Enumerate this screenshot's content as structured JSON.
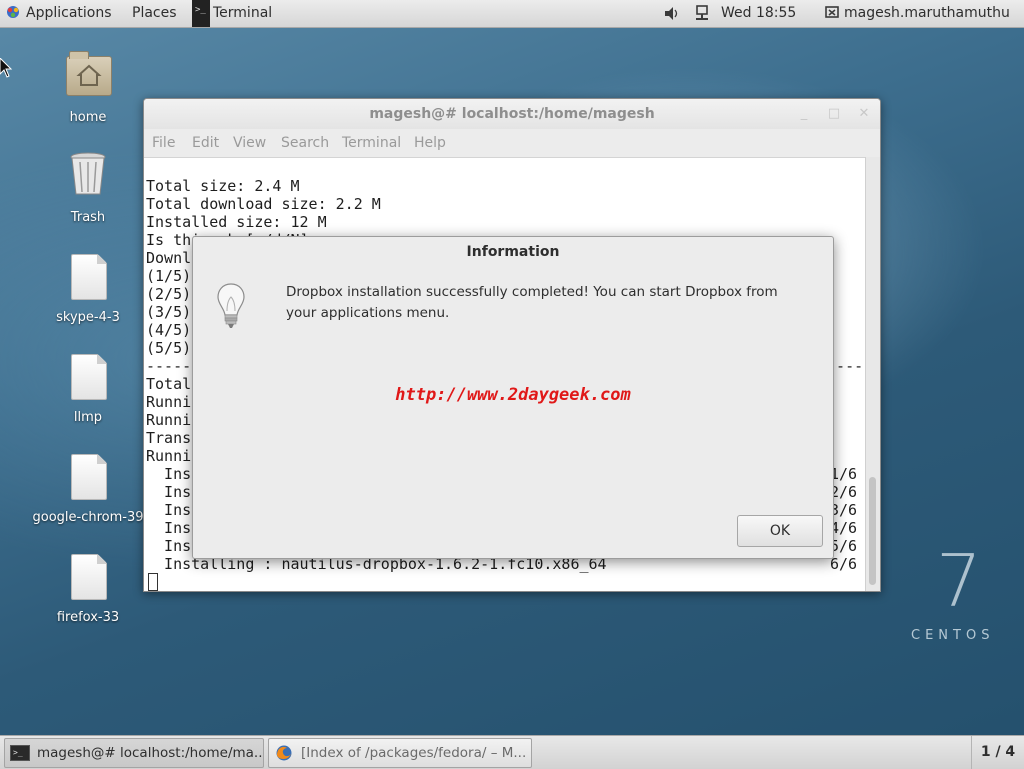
{
  "top_bar": {
    "applications_label": "Applications",
    "places_label": "Places",
    "terminal_label": "Terminal",
    "clock": "Wed 18:55",
    "user_name": "magesh.maruthamuthu",
    "icons": [
      "applications-icon",
      "terminal-icon",
      "volume-icon",
      "network-icon",
      "user-icon"
    ]
  },
  "desktop_icons": [
    {
      "label": "home",
      "icon": "home-folder-icon"
    },
    {
      "label": "Trash",
      "icon": "trash-icon"
    },
    {
      "label": "skype-4-3",
      "icon": "file-icon"
    },
    {
      "label": "llmp",
      "icon": "file-icon"
    },
    {
      "label": "google-chrom-39",
      "icon": "file-icon"
    },
    {
      "label": "firefox-33",
      "icon": "file-icon"
    }
  ],
  "terminal": {
    "title": "magesh@# localhost:/home/magesh",
    "menu": [
      "File",
      "Edit",
      "View",
      "Search",
      "Terminal",
      "Help"
    ],
    "lines": [
      "Total size: 2.4 M",
      "Total download size: 2.2 M",
      "Installed size: 12 M",
      "Is this ok [y/d/N]",
      "Downl",
      "(1/5)",
      "(2/5)",
      "(3/5)",
      "(4/5)",
      "(5/5)",
      "-----",
      "Total",
      "Runnin",
      "Runnin",
      "Transa",
      "Runnin",
      "  Inst",
      "  Inst",
      "  Inst",
      "  Inst",
      "  Inst",
      "  Installing : nautilus-dropbox-1.6.2-1.fc10.x86_64"
    ],
    "right_column": [
      "-----",
      "1/6",
      "2/6",
      "3/6",
      "4/6",
      "5/6",
      "6/6"
    ]
  },
  "dialog": {
    "title": "Information",
    "message": "Dropbox installation successfully completed! You can start Dropbox from your applications menu.",
    "watermark": "http://www.2daygeek.com",
    "ok_label": "OK",
    "icon": "lightbulb-icon"
  },
  "branding": {
    "centos_number": "7",
    "centos_word": "CENTOS"
  },
  "taskbar": {
    "tasks": [
      {
        "label": "magesh@# localhost:/home/ma...",
        "icon": "terminal-icon",
        "active": true
      },
      {
        "label": "[Index of /packages/fedora/ – M...",
        "icon": "firefox-icon",
        "active": false
      }
    ],
    "workspace": "1 / 4"
  }
}
